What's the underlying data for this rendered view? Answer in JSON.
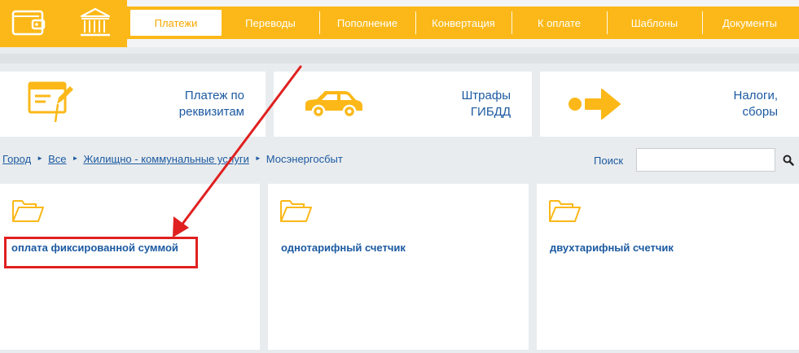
{
  "nav": {
    "tabs": [
      {
        "label": "Платежи",
        "active": true
      },
      {
        "label": "Переводы",
        "active": false
      },
      {
        "label": "Пополнение",
        "active": false
      },
      {
        "label": "Конвертация",
        "active": false
      },
      {
        "label": "К оплате",
        "active": false
      },
      {
        "label": "Шаблоны",
        "active": false
      },
      {
        "label": "Документы",
        "active": false
      }
    ]
  },
  "services": [
    {
      "label_line1": "Платеж по",
      "label_line2": "реквизитам",
      "icon": "payment-form-icon"
    },
    {
      "label_line1": "Штрафы",
      "label_line2": "ГИБДД",
      "icon": "car-icon"
    },
    {
      "label_line1": "Налоги,",
      "label_line2": "сборы",
      "icon": "arrow-right-icon"
    }
  ],
  "breadcrumb": {
    "items": [
      "Город",
      "Все",
      "Жилищно - коммунальные услуги"
    ],
    "current": "Мосэнергосбыт"
  },
  "search": {
    "label": "Поиск",
    "value": "",
    "placeholder": ""
  },
  "categories": [
    {
      "title": "оплата фиксированной суммой",
      "highlighted": true
    },
    {
      "title": "однотарифный счетчик",
      "highlighted": false
    },
    {
      "title": "двухтарифный счетчик",
      "highlighted": false
    }
  ],
  "colors": {
    "brand_yellow": "#fbb818",
    "link_blue": "#1c5aa1",
    "annotation_red": "#e02020"
  }
}
